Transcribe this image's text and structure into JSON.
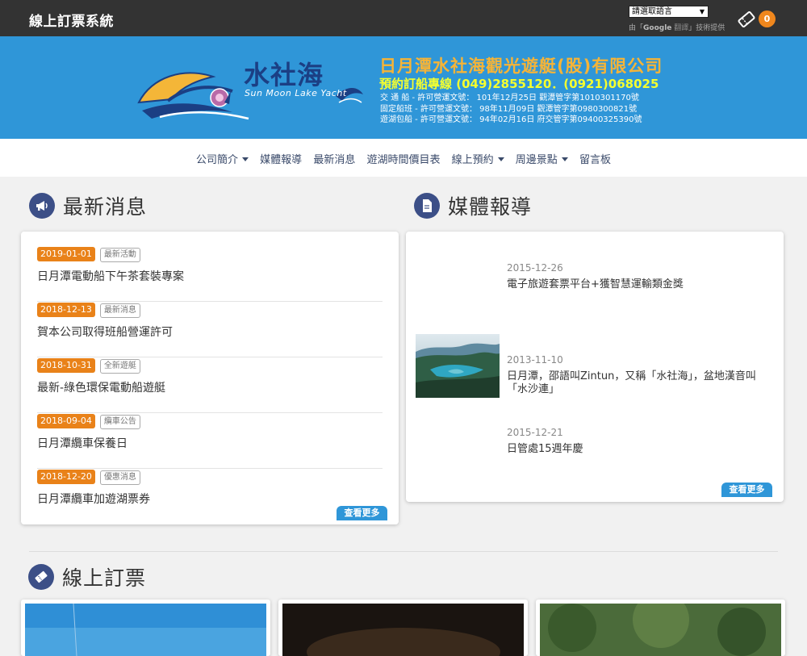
{
  "header": {
    "site_title": "線上訂票系統",
    "language_select": "請選取語言",
    "google_credit_prefix": "由「",
    "google_brand": "Google",
    "google_translate": "翻譯",
    "google_credit_suffix": "」技術提供",
    "cart_count": "0"
  },
  "banner": {
    "logo_cn": "水社海",
    "logo_en": "Sun Moon Lake Yacht",
    "company_name": "日月潭水社海觀光遊艇(股)有限公司",
    "hotline": "預約訂船專線 (049)2855120．(0921)068025",
    "permits": [
      "交 通 船 - 許可營運文號： 101年12月25日 觀潭管字第1010301170號",
      "固定船班 - 許可營運文號：  98年11月09日 觀潭管字第0980300821號",
      "遊湖包船 - 許可營運文號：  94年02月16日 府交管字第09400325390號"
    ]
  },
  "nav": {
    "items": [
      "公司簡介",
      "媒體報導",
      "最新消息",
      "遊湖時間價目表",
      "線上預約",
      "周邊景點",
      "留言板"
    ]
  },
  "latest_news": {
    "heading": "最新消息",
    "more": "查看更多",
    "items": [
      {
        "date": "2019-01-01",
        "category": "最新活動",
        "title": "日月潭電動船下午茶套裝專案"
      },
      {
        "date": "2018-12-13",
        "category": "最新消息",
        "title": "賀本公司取得班船營運許可"
      },
      {
        "date": "2018-10-31",
        "category": "全新遊艇",
        "title": "最新-綠色環保電動船遊艇"
      },
      {
        "date": "2018-09-04",
        "category": "纜車公告",
        "title": "日月潭纜車保養日"
      },
      {
        "date": "2018-12-20",
        "category": "優惠消息",
        "title": "日月潭纜車加遊湖票券"
      }
    ]
  },
  "media": {
    "heading": "媒體報導",
    "more": "查看更多",
    "items": [
      {
        "date": "2015-12-26",
        "title": "電子旅遊套票平台+獲智慧運輸類金獎"
      },
      {
        "date": "2013-11-10",
        "title": "日月潭，邵語叫Zintun，又稱「水社海」，盆地漢音叫「水沙連」"
      },
      {
        "date": "2015-12-21",
        "title": "日管處15週年慶"
      }
    ]
  },
  "online_ticket": {
    "heading": "線上訂票"
  },
  "colors": {
    "topbar": "#333333",
    "banner": "#2f96d8",
    "accent_orange": "#e98219",
    "icon_navy": "#3c4f87"
  }
}
